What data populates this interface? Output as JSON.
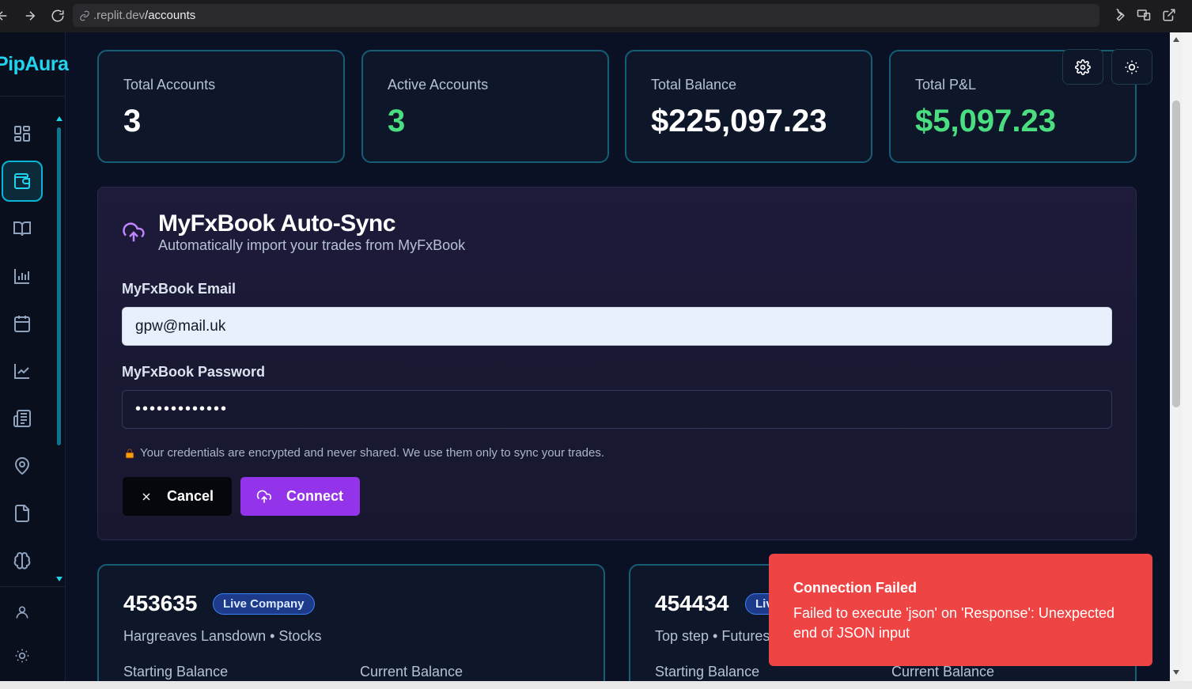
{
  "browser": {
    "url_host": ".replit.dev",
    "url_path": "/accounts"
  },
  "sidebar": {
    "brand": "PipAura",
    "items": [
      {
        "icon": "dashboard-grid-icon",
        "active": false
      },
      {
        "icon": "wallet-icon",
        "active": true
      },
      {
        "icon": "book-open-icon",
        "active": false
      },
      {
        "icon": "bar-chart-icon",
        "active": false
      },
      {
        "icon": "calendar-icon",
        "active": false
      },
      {
        "icon": "line-chart-icon",
        "active": false
      },
      {
        "icon": "newspaper-icon",
        "active": false
      },
      {
        "icon": "map-pin-icon",
        "active": false
      },
      {
        "icon": "file-icon",
        "active": false
      },
      {
        "icon": "brain-icon",
        "active": false
      }
    ],
    "footer": [
      {
        "icon": "user-icon"
      },
      {
        "icon": "sun-icon"
      }
    ]
  },
  "stats": [
    {
      "label": "Total Accounts",
      "value": "3",
      "color": "#ffffff"
    },
    {
      "label": "Active Accounts",
      "value": "3",
      "color": "#4ade80"
    },
    {
      "label": "Total Balance",
      "value": "$225,097.23",
      "color": "#ffffff"
    },
    {
      "label": "Total P&L",
      "value": "$5,097.23",
      "color": "#4ade80"
    }
  ],
  "sync": {
    "title": "MyFxBook Auto-Sync",
    "subtitle": "Automatically import your trades from MyFxBook",
    "email_label": "MyFxBook Email",
    "email_value": "gpw@mail.uk",
    "password_label": "MyFxBook Password",
    "password_value": "•••••••••••••",
    "note": "Your credentials are encrypted and never shared. We use them only to sync your trades.",
    "cancel_label": "Cancel",
    "connect_label": "Connect"
  },
  "accounts": [
    {
      "id": "453635",
      "badge": "Live Company",
      "broker": "Hargreaves Lansdown",
      "market": "Stocks",
      "starting_label": "Starting Balance",
      "current_label": "Current Balance"
    },
    {
      "id": "454434",
      "badge": "Live",
      "broker": "Top step",
      "market": "Futures",
      "starting_label": "Starting Balance",
      "current_label": "Current Balance"
    }
  ],
  "toast": {
    "title": "Connection Failed",
    "message": "Failed to execute 'json' on 'Response': Unexpected end of JSON input"
  },
  "colors": {
    "accent": "#22d3ee",
    "positive": "#4ade80",
    "connect": "#9333ea",
    "error": "#ef4444"
  }
}
